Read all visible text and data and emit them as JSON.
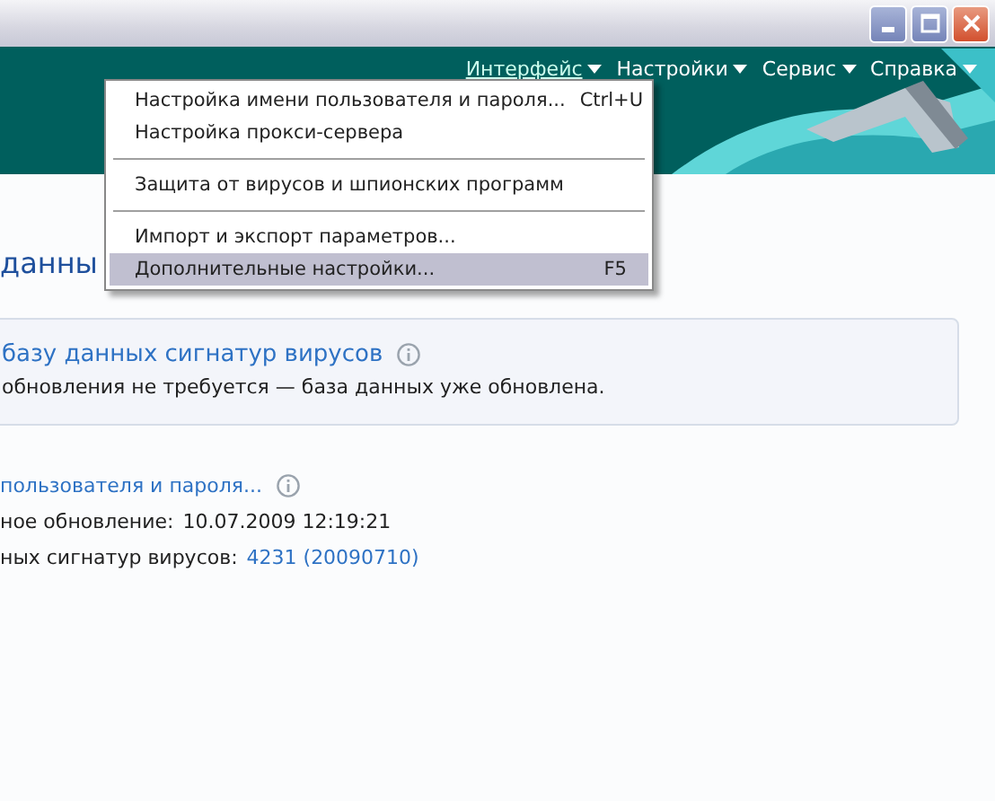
{
  "menubar": [
    {
      "label": "Интерфейс",
      "selected": true
    },
    {
      "label": "Настройки",
      "selected": false
    },
    {
      "label": "Сервис",
      "selected": false
    },
    {
      "label": "Справка",
      "selected": false
    }
  ],
  "dropdown": [
    {
      "kind": "item",
      "label": "Настройка имени пользователя и пароля...",
      "shortcut": "Ctrl+U",
      "selected": false
    },
    {
      "kind": "item",
      "label": "Настройка прокси-сервера",
      "selected": false
    },
    {
      "kind": "separator"
    },
    {
      "kind": "item",
      "label": "Защита от вирусов и шпионских программ",
      "selected": false
    },
    {
      "kind": "separator"
    },
    {
      "kind": "item",
      "label": "Импорт и экспорт параметров...",
      "selected": false
    },
    {
      "kind": "item",
      "label": "Дополнительные настройки...",
      "shortcut": "F5",
      "selected": true
    }
  ],
  "heading": "данны",
  "card": {
    "title": "базу данных сигнатур вирусов",
    "text": "обновления не требуется — база данных уже обновлена."
  },
  "details": {
    "link": "пользователя и пароля...",
    "rows": [
      {
        "label": "ное обновление:",
        "value": "10.07.2009 12:19:21",
        "link": false
      },
      {
        "label": "ных сигнатур вирусов:",
        "value": "4231 (20090710)",
        "link": true
      }
    ]
  }
}
